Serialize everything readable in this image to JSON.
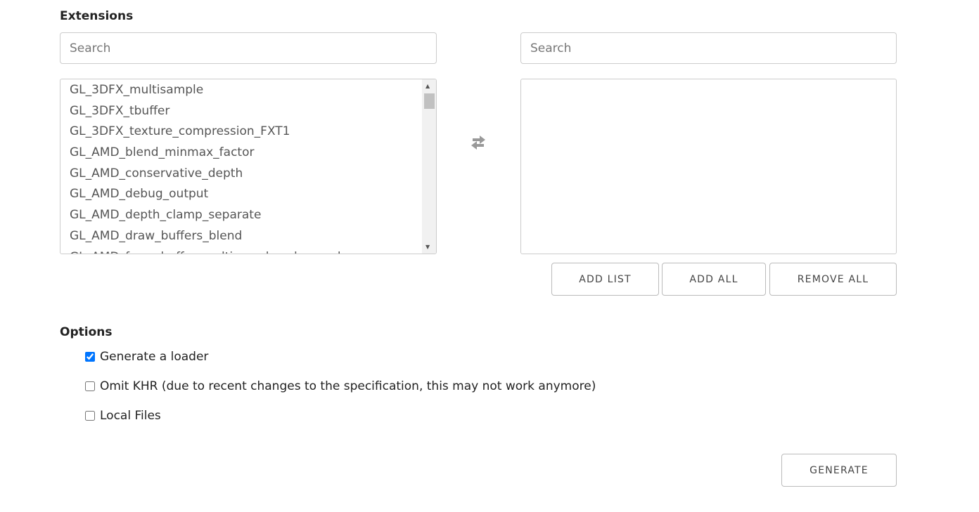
{
  "extensions": {
    "title": "Extensions",
    "left_search_placeholder": "Search",
    "right_search_placeholder": "Search",
    "available": [
      "GL_3DFX_multisample",
      "GL_3DFX_tbuffer",
      "GL_3DFX_texture_compression_FXT1",
      "GL_AMD_blend_minmax_factor",
      "GL_AMD_conservative_depth",
      "GL_AMD_debug_output",
      "GL_AMD_depth_clamp_separate",
      "GL_AMD_draw_buffers_blend",
      "GL_AMD_framebuffer_multisample_advanced"
    ],
    "selected": [],
    "swap_icon": "swap-arrows-icon",
    "buttons": {
      "add_list": "ADD LIST",
      "add_all": "ADD ALL",
      "remove_all": "REMOVE ALL"
    }
  },
  "options": {
    "title": "Options",
    "items": [
      {
        "label": "Generate a loader",
        "checked": true
      },
      {
        "label": "Omit KHR (due to recent changes to the specification, this may not work anymore)",
        "checked": false
      },
      {
        "label": "Local Files",
        "checked": false
      }
    ]
  },
  "generate_label": "GENERATE"
}
